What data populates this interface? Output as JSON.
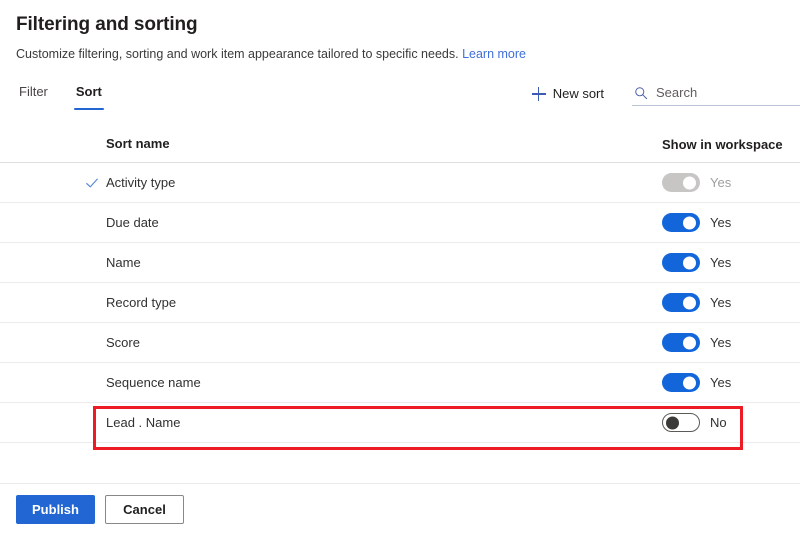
{
  "header": {
    "title": "Filtering and sorting",
    "subtitle": "Customize filtering, sorting and work item appearance tailored to specific needs.",
    "learn_more_label": "Learn more"
  },
  "tabs": [
    {
      "label": "Filter",
      "active": false
    },
    {
      "label": "Sort",
      "active": true
    }
  ],
  "toolbar": {
    "new_sort_label": "New sort",
    "search_placeholder": "Search",
    "search_value": ""
  },
  "table": {
    "columns": {
      "name": "Sort name",
      "show_in_workspace": "Show in workspace"
    },
    "rows": [
      {
        "name": "Activity type",
        "checked": true,
        "toggle_state": "on",
        "toggle_disabled": true,
        "toggle_label": "Yes"
      },
      {
        "name": "Due date",
        "checked": false,
        "toggle_state": "on",
        "toggle_disabled": false,
        "toggle_label": "Yes"
      },
      {
        "name": "Name",
        "checked": false,
        "toggle_state": "on",
        "toggle_disabled": false,
        "toggle_label": "Yes"
      },
      {
        "name": "Record type",
        "checked": false,
        "toggle_state": "on",
        "toggle_disabled": false,
        "toggle_label": "Yes"
      },
      {
        "name": "Score",
        "checked": false,
        "toggle_state": "on",
        "toggle_disabled": false,
        "toggle_label": "Yes"
      },
      {
        "name": "Sequence name",
        "checked": false,
        "toggle_state": "on",
        "toggle_disabled": false,
        "toggle_label": "Yes"
      },
      {
        "name": "Lead . Name",
        "checked": false,
        "toggle_state": "off",
        "toggle_disabled": false,
        "toggle_label": "No",
        "highlighted": true
      }
    ]
  },
  "footer": {
    "publish_label": "Publish",
    "cancel_label": "Cancel"
  },
  "colors": {
    "accent": "#2266d3",
    "toggle_on": "#1266da",
    "link": "#3f6fd8",
    "annotation": "#ed1c24",
    "toggle_disabled": "#c8c6c4"
  }
}
